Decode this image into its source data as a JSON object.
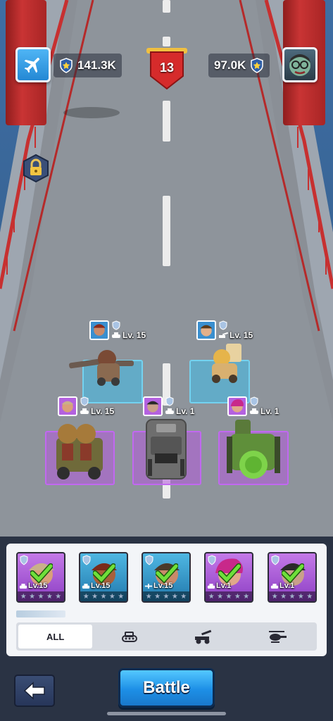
{
  "hud": {
    "player_score": "141.3K",
    "opponent_score": "97.0K",
    "round_number": "13"
  },
  "units": [
    {
      "name": "enemy-left",
      "level": "Lv. 15"
    },
    {
      "name": "enemy-right",
      "level": "Lv. 15"
    },
    {
      "name": "player-left",
      "level": "Lv. 15"
    },
    {
      "name": "player-center",
      "level": "Lv. 1"
    },
    {
      "name": "player-right",
      "level": "Lv. 1"
    }
  ],
  "cards": [
    {
      "level": "Lv.15",
      "color": "purple",
      "unit_icon": "tank-icon"
    },
    {
      "level": "Lv.15",
      "color": "blue",
      "unit_icon": "tank-icon"
    },
    {
      "level": "Lv.15",
      "color": "blue",
      "unit_icon": "plane-icon"
    },
    {
      "level": "Lv.1",
      "color": "purple",
      "unit_icon": "tank-icon"
    },
    {
      "level": "Lv.1",
      "color": "purple",
      "unit_icon": "tank-icon"
    }
  ],
  "filters": [
    {
      "label": "ALL",
      "icon": "",
      "active": true
    },
    {
      "label": "",
      "icon": "tank-icon",
      "active": false
    },
    {
      "label": "",
      "icon": "artillery-icon",
      "active": false
    },
    {
      "label": "",
      "icon": "helicopter-icon",
      "active": false
    }
  ],
  "buttons": {
    "battle_label": "Battle"
  },
  "colors": {
    "accent": "#1d8fe6",
    "bridge_red": "#c93434",
    "tile_blue": "#40beeb",
    "tile_purple": "#b45adc"
  }
}
